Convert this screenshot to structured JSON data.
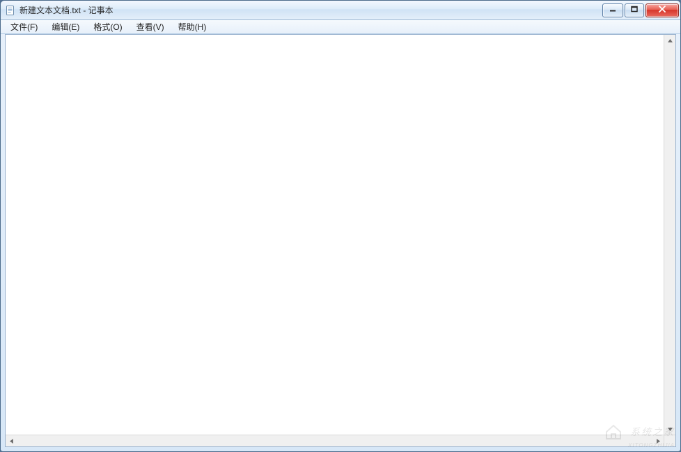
{
  "window": {
    "title": "新建文本文档.txt - 记事本"
  },
  "menubar": {
    "items": [
      {
        "label": "文件(F)"
      },
      {
        "label": "编辑(E)"
      },
      {
        "label": "格式(O)"
      },
      {
        "label": "查看(V)"
      },
      {
        "label": "帮助(H)"
      }
    ]
  },
  "editor": {
    "content": ""
  },
  "buttons": {
    "minimize_title": "最小化",
    "maximize_title": "最大化",
    "close_title": "关闭"
  },
  "watermark": {
    "text": "系统之家",
    "sub": "XITONGZHIJIA"
  }
}
